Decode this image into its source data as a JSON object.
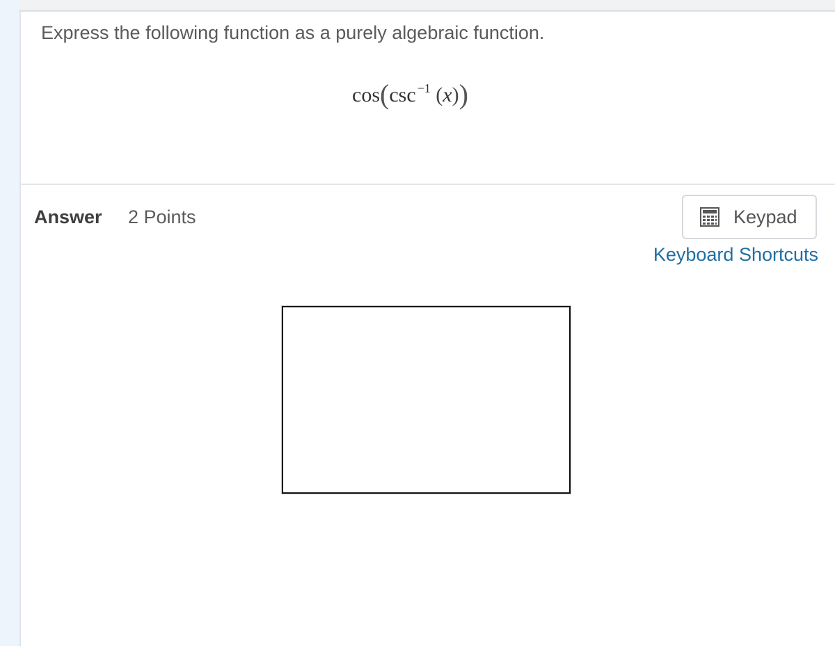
{
  "question": {
    "prompt": "Express the following function as a purely algebraic function.",
    "expression": {
      "outer": "cos",
      "inner": "csc",
      "exponent": "−1",
      "variable": "x"
    }
  },
  "answer": {
    "label": "Answer",
    "points": "2 Points"
  },
  "tools": {
    "keypad_label": "Keypad",
    "keyboard_shortcuts_label": "Keyboard Shortcuts"
  },
  "colors": {
    "link": "#1f6fa3",
    "text": "#5a5a5a",
    "border": "#d6d9dd"
  },
  "icons": {
    "keypad": "calculator-icon"
  }
}
